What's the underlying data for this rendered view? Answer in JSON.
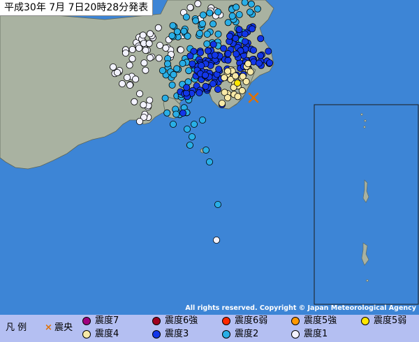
{
  "title": "平成30年 7月 7日20時28分発表",
  "copyright": "All rights reserved. Copyright © Japan Meteorological Agency",
  "legend": {
    "label": "凡 例",
    "epicenter": "震央",
    "items": [
      {
        "key": "i7",
        "label": "震度7",
        "color": "#a0007f"
      },
      {
        "key": "i6p",
        "label": "震度6強",
        "color": "#a00020"
      },
      {
        "key": "i6m",
        "label": "震度6弱",
        "color": "#ff2800"
      },
      {
        "key": "i5p",
        "label": "震度5強",
        "color": "#ff9900"
      },
      {
        "key": "i5m",
        "label": "震度5弱",
        "color": "#ffe600"
      },
      {
        "key": "i4",
        "label": "震度4",
        "color": "#f7e9a7"
      },
      {
        "key": "i3",
        "label": "震度3",
        "color": "#1236e8"
      },
      {
        "key": "i2",
        "label": "震度2",
        "color": "#29aee6"
      },
      {
        "key": "i1",
        "label": "震度1",
        "color": "#f2f2ff"
      }
    ]
  },
  "colors": {
    "sea": "#3d85d6",
    "land": "#a9b2a1",
    "epicenter": "#e07000"
  }
}
